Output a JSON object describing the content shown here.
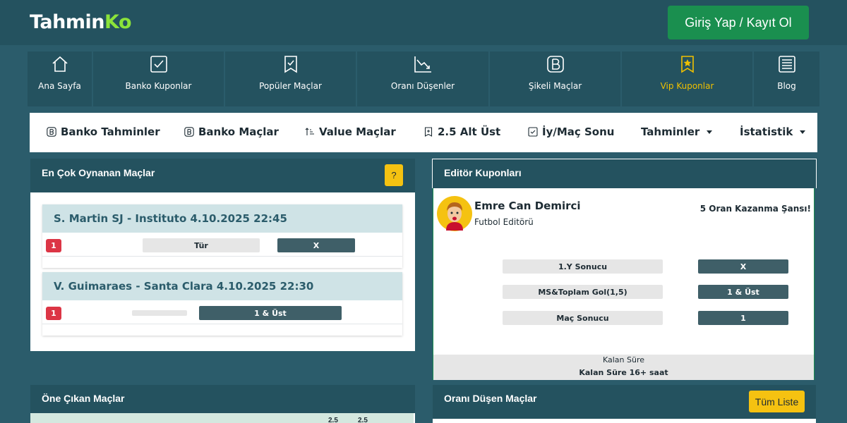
{
  "brand": {
    "logo_main": "Tahmin",
    "logo_accent": "Ko",
    "accent_color": "#8be33a"
  },
  "header": {
    "login_label": "Giriş Yap / Kayıt Ol"
  },
  "main_nav": [
    {
      "label": "Ana Sayfa",
      "icon": "home-icon"
    },
    {
      "label": "Banko Kuponlar",
      "icon": "check-square-icon"
    },
    {
      "label": "Popüler Maçlar",
      "icon": "bookmark-check-icon"
    },
    {
      "label": "Oranı Düşenler",
      "icon": "chart-down-icon"
    },
    {
      "label": "Şikeli Maçlar",
      "icon": "b-square-icon"
    },
    {
      "label": "Vip Kuponlar",
      "icon": "bookmark-star-icon"
    },
    {
      "label": "Blog",
      "icon": "newspaper-icon"
    }
  ],
  "sub_nav": [
    {
      "label": "Banko Tahminler",
      "icon": "b-circle-icon"
    },
    {
      "label": "Banko Maçlar",
      "icon": "b-circle-icon"
    },
    {
      "label": "Value Maçlar",
      "icon": "sort-up-icon"
    },
    {
      "label": "2.5 Alt Üst",
      "icon": "bookmark-plus-icon"
    },
    {
      "label": "İy/Maç Sonu",
      "icon": "check-square-icon"
    },
    {
      "label": "Tahminler",
      "icon": "caret-down-icon"
    },
    {
      "label": "İstatistik",
      "icon": "caret-down-icon"
    }
  ],
  "most_played": {
    "title": "En Çok Oynanan Maçlar",
    "help_label": "?",
    "matches": [
      {
        "title": "S. Martin SJ - Instituto 4.10.2025 22:45",
        "badge": "1",
        "market": "Tür",
        "pick": "X"
      },
      {
        "title": "V. Guimaraes - Santa Clara 4.10.2025 22:30",
        "badge": "1",
        "market": "",
        "pick": "1 & Üst"
      }
    ]
  },
  "editor": {
    "title": "Editör Kuponları",
    "name": "Emre Can Demirci",
    "role": "Futbol Editörü",
    "chance": "5 Oran Kazanma Şansı!",
    "picks": [
      {
        "market": "1.Y Sonucu",
        "pick": "X"
      },
      {
        "market": "MS&Toplam Gol(1,5)",
        "pick": "1 & Üst"
      },
      {
        "market": "Maç Sonucu",
        "pick": "1"
      }
    ],
    "remaining_label": "Kalan Süre",
    "remaining_value": "Kalan Süre 16+ saat"
  },
  "featured": {
    "title": "Öne Çıkan Maçlar",
    "col_a": "2.5",
    "col_b": "2.5"
  },
  "dropping": {
    "title": "Oranı Düşen Maçlar",
    "all_label": "Tüm Liste"
  }
}
